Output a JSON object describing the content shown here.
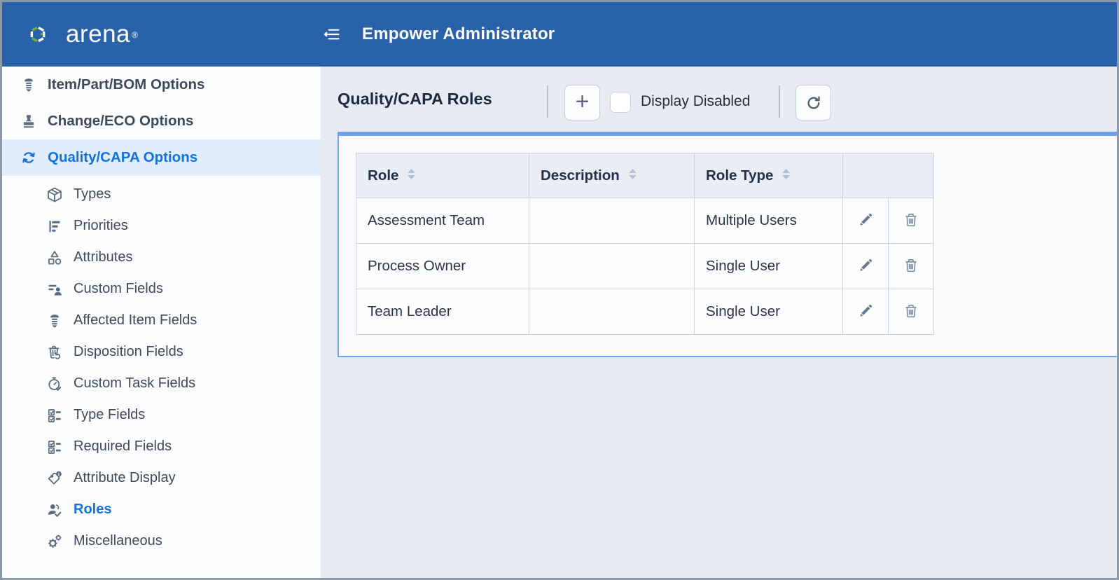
{
  "header": {
    "brand": "arena",
    "brand_mark": "®",
    "title": "Empower Administrator"
  },
  "sidebar": {
    "items": [
      {
        "label": "Item/Part/BOM Options",
        "icon": "screw-icon",
        "level": 0,
        "active": false
      },
      {
        "label": "Change/ECO Options",
        "icon": "stamp-icon",
        "level": 0,
        "active": false
      },
      {
        "label": "Quality/CAPA Options",
        "icon": "sync-icon",
        "level": 0,
        "active": true
      },
      {
        "label": "Types",
        "icon": "cube-icon",
        "level": 1,
        "active": false
      },
      {
        "label": "Priorities",
        "icon": "priority-bars-icon",
        "level": 1,
        "active": false
      },
      {
        "label": "Attributes",
        "icon": "shapes-icon",
        "level": 1,
        "active": false
      },
      {
        "label": "Custom Fields",
        "icon": "fields-person-icon",
        "level": 1,
        "active": false
      },
      {
        "label": "Affected Item Fields",
        "icon": "screw-icon",
        "level": 1,
        "active": false
      },
      {
        "label": "Disposition Fields",
        "icon": "trash-recycle-icon",
        "level": 1,
        "active": false
      },
      {
        "label": "Custom Task Fields",
        "icon": "stopwatch-check-icon",
        "level": 1,
        "active": false
      },
      {
        "label": "Type Fields",
        "icon": "checklist-icon",
        "level": 1,
        "active": false
      },
      {
        "label": "Required Fields",
        "icon": "checklist-icon",
        "level": 1,
        "active": false
      },
      {
        "label": "Attribute Display",
        "icon": "tag-info-icon",
        "level": 1,
        "active": false
      },
      {
        "label": "Roles",
        "icon": "roles-check-icon",
        "level": 1,
        "active": true
      },
      {
        "label": "Miscellaneous",
        "icon": "gears-icon",
        "level": 1,
        "active": false
      }
    ]
  },
  "toolbar": {
    "title": "Quality/CAPA Roles",
    "add_label": "+",
    "display_disabled_label": "Display Disabled",
    "display_disabled_checked": false
  },
  "table": {
    "columns": [
      "Role",
      "Description",
      "Role Type"
    ],
    "rows": [
      {
        "role": "Assessment Team",
        "description": "",
        "role_type": "Multiple Users"
      },
      {
        "role": "Process Owner",
        "description": "",
        "role_type": "Single User"
      },
      {
        "role": "Team Leader",
        "description": "",
        "role_type": "Single User"
      }
    ]
  },
  "colors": {
    "header_bg": "#2a62a9",
    "accent_blue": "#1272e4",
    "active_item_bg": "#e1edfc",
    "panel_border": "#70a1e8",
    "main_bg": "#e9ebf2",
    "table_header_bg": "#e9edf5",
    "table_border": "#cdd5e1",
    "icon_slate": "#5b6b80",
    "logo_green": "#6cb33f",
    "frame": "#8c9aa7"
  }
}
